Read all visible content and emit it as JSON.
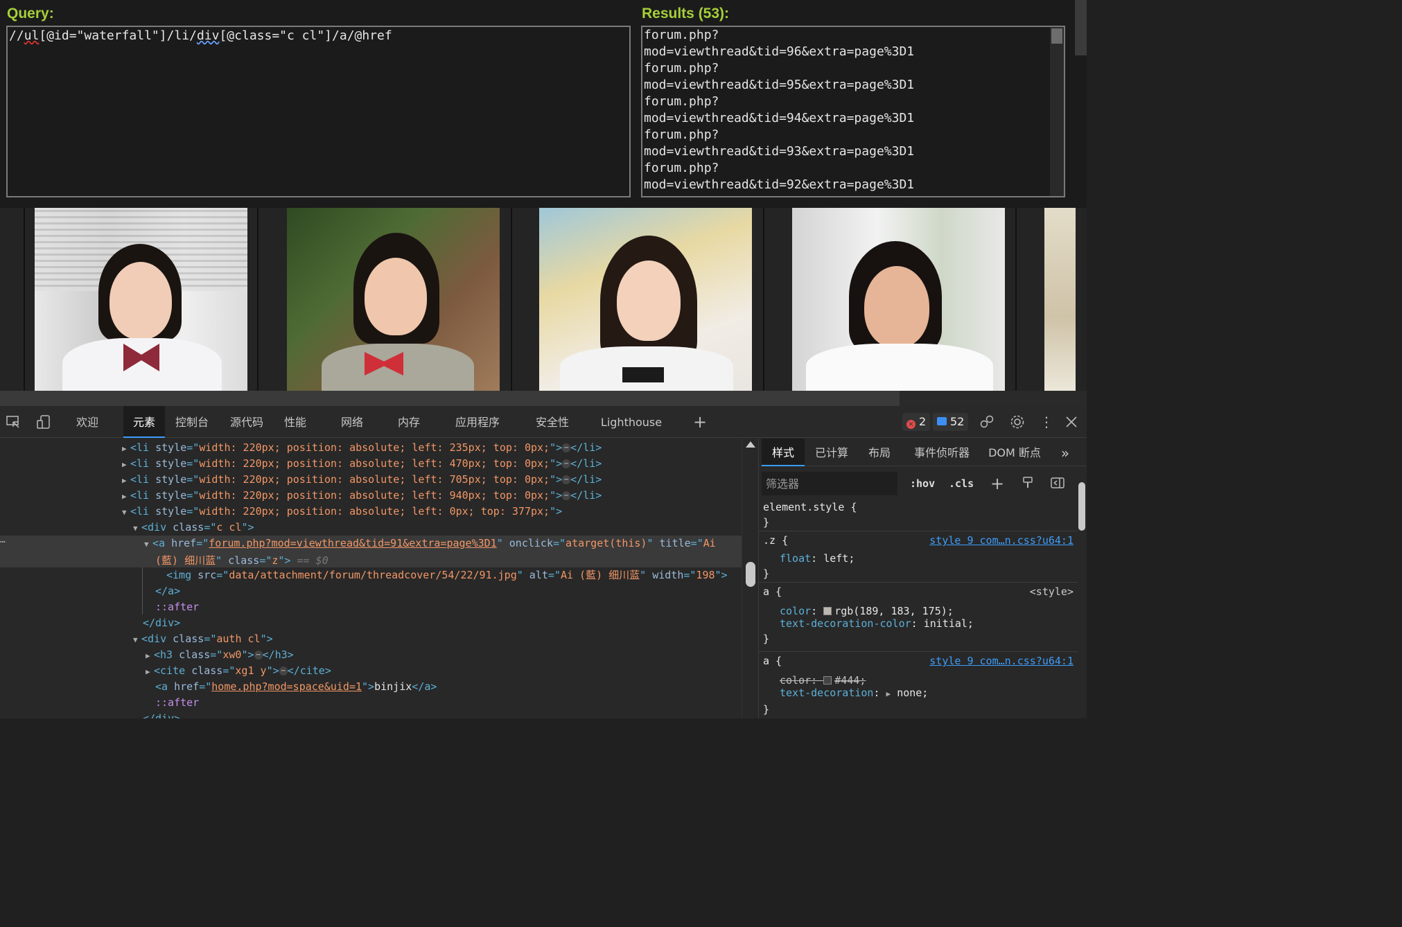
{
  "xpath_helper": {
    "query_label": "Query:",
    "query_text_parts": [
      "//",
      "ul",
      "[@id=\"waterfall\"]/li/",
      "div",
      "[@class=\"c cl\"]/a/@href"
    ],
    "results_label": "Results (53):",
    "results_lines": [
      "forum.php?",
      "mod=viewthread&tid=96&extra=page%3D1",
      "forum.php?",
      "mod=viewthread&tid=95&extra=page%3D1",
      "forum.php?",
      "mod=viewthread&tid=94&extra=page%3D1",
      "forum.php?",
      "mod=viewthread&tid=93&extra=page%3D1",
      "forum.php?",
      "mod=viewthread&tid=92&extra=page%3D1"
    ]
  },
  "waterfall": {
    "photos": [
      "girl-photo-1",
      "girl-photo-2",
      "girl-photo-3",
      "girl-photo-4",
      "girl-photo-5"
    ]
  },
  "devtools": {
    "tabs": [
      "欢迎",
      "元素",
      "控制台",
      "源代码",
      "性能",
      "网络",
      "内存",
      "应用程序",
      "安全性",
      "Lighthouse"
    ],
    "active_tab": "元素",
    "error_count": "2",
    "message_count": "52",
    "icons": [
      "inspect-icon",
      "device-toggle-icon",
      "add-tab-icon",
      "error-icon",
      "message-icon",
      "connections-icon",
      "gear-icon",
      "more-icon",
      "close-icon"
    ],
    "dom": {
      "li_lines": [
        {
          "style": "width: 220px; position: absolute; left: 235px; top: 0px;"
        },
        {
          "style": "width: 220px; position: absolute; left: 470px; top: 0px;"
        },
        {
          "style": "width: 220px; position: absolute; left: 705px; top: 0px;"
        },
        {
          "style": "width: 220px; position: absolute; left: 940px; top: 0px;"
        }
      ],
      "open_li_style": "width: 220px; position: absolute; left: 0px; top: 377px;",
      "div_class": "c cl",
      "a_href": "forum.php?mod=viewthread&tid=91&extra=page%3D1",
      "a_onclick": "atarget(this)",
      "a_title_1": "Ai",
      "a_title_2": "(藍) 细川蓝",
      "a_class": "z",
      "selected_marker": "== $0",
      "img_src": "data/attachment/forum/threadcover/54/22/91.jpg",
      "img_alt": "Ai (藍) 细川蓝",
      "img_width": "198",
      "pseudo_after": "::after",
      "auth_div_class": "auth cl",
      "h3_class": "xw0",
      "cite_class": "xg1 y",
      "home_href": "home.php?mod=space&uid=1",
      "home_text": "binjix"
    },
    "styles": {
      "tabs": [
        "样式",
        "已计算",
        "布局",
        "事件侦听器",
        "DOM 断点"
      ],
      "active_tab": "样式",
      "more_icon": "chevron-double-right-icon",
      "filter_placeholder": "筛选器",
      "hov": ":hov",
      "cls": ".cls",
      "element_style": "element.style {",
      "close_brace": "}",
      "rule_z": {
        "selector": ".z {",
        "source": "style 9 com…n.css?u64:1",
        "prop": "float",
        "value": "left;"
      },
      "rule_a1": {
        "selector": "a {",
        "source": "<style>",
        "prop1": "color",
        "value1": "rgb(189, 183, 175);",
        "swatch1": "#bdb7af",
        "prop2": "text-decoration-color",
        "value2": "initial;"
      },
      "rule_a2": {
        "selector": "a {",
        "source": "style 9 com…n.css?u64:1",
        "prop1": "color",
        "value1": "#444;",
        "swatch1": "#444444",
        "prop2": "text-decoration",
        "value2": "none;"
      }
    }
  }
}
